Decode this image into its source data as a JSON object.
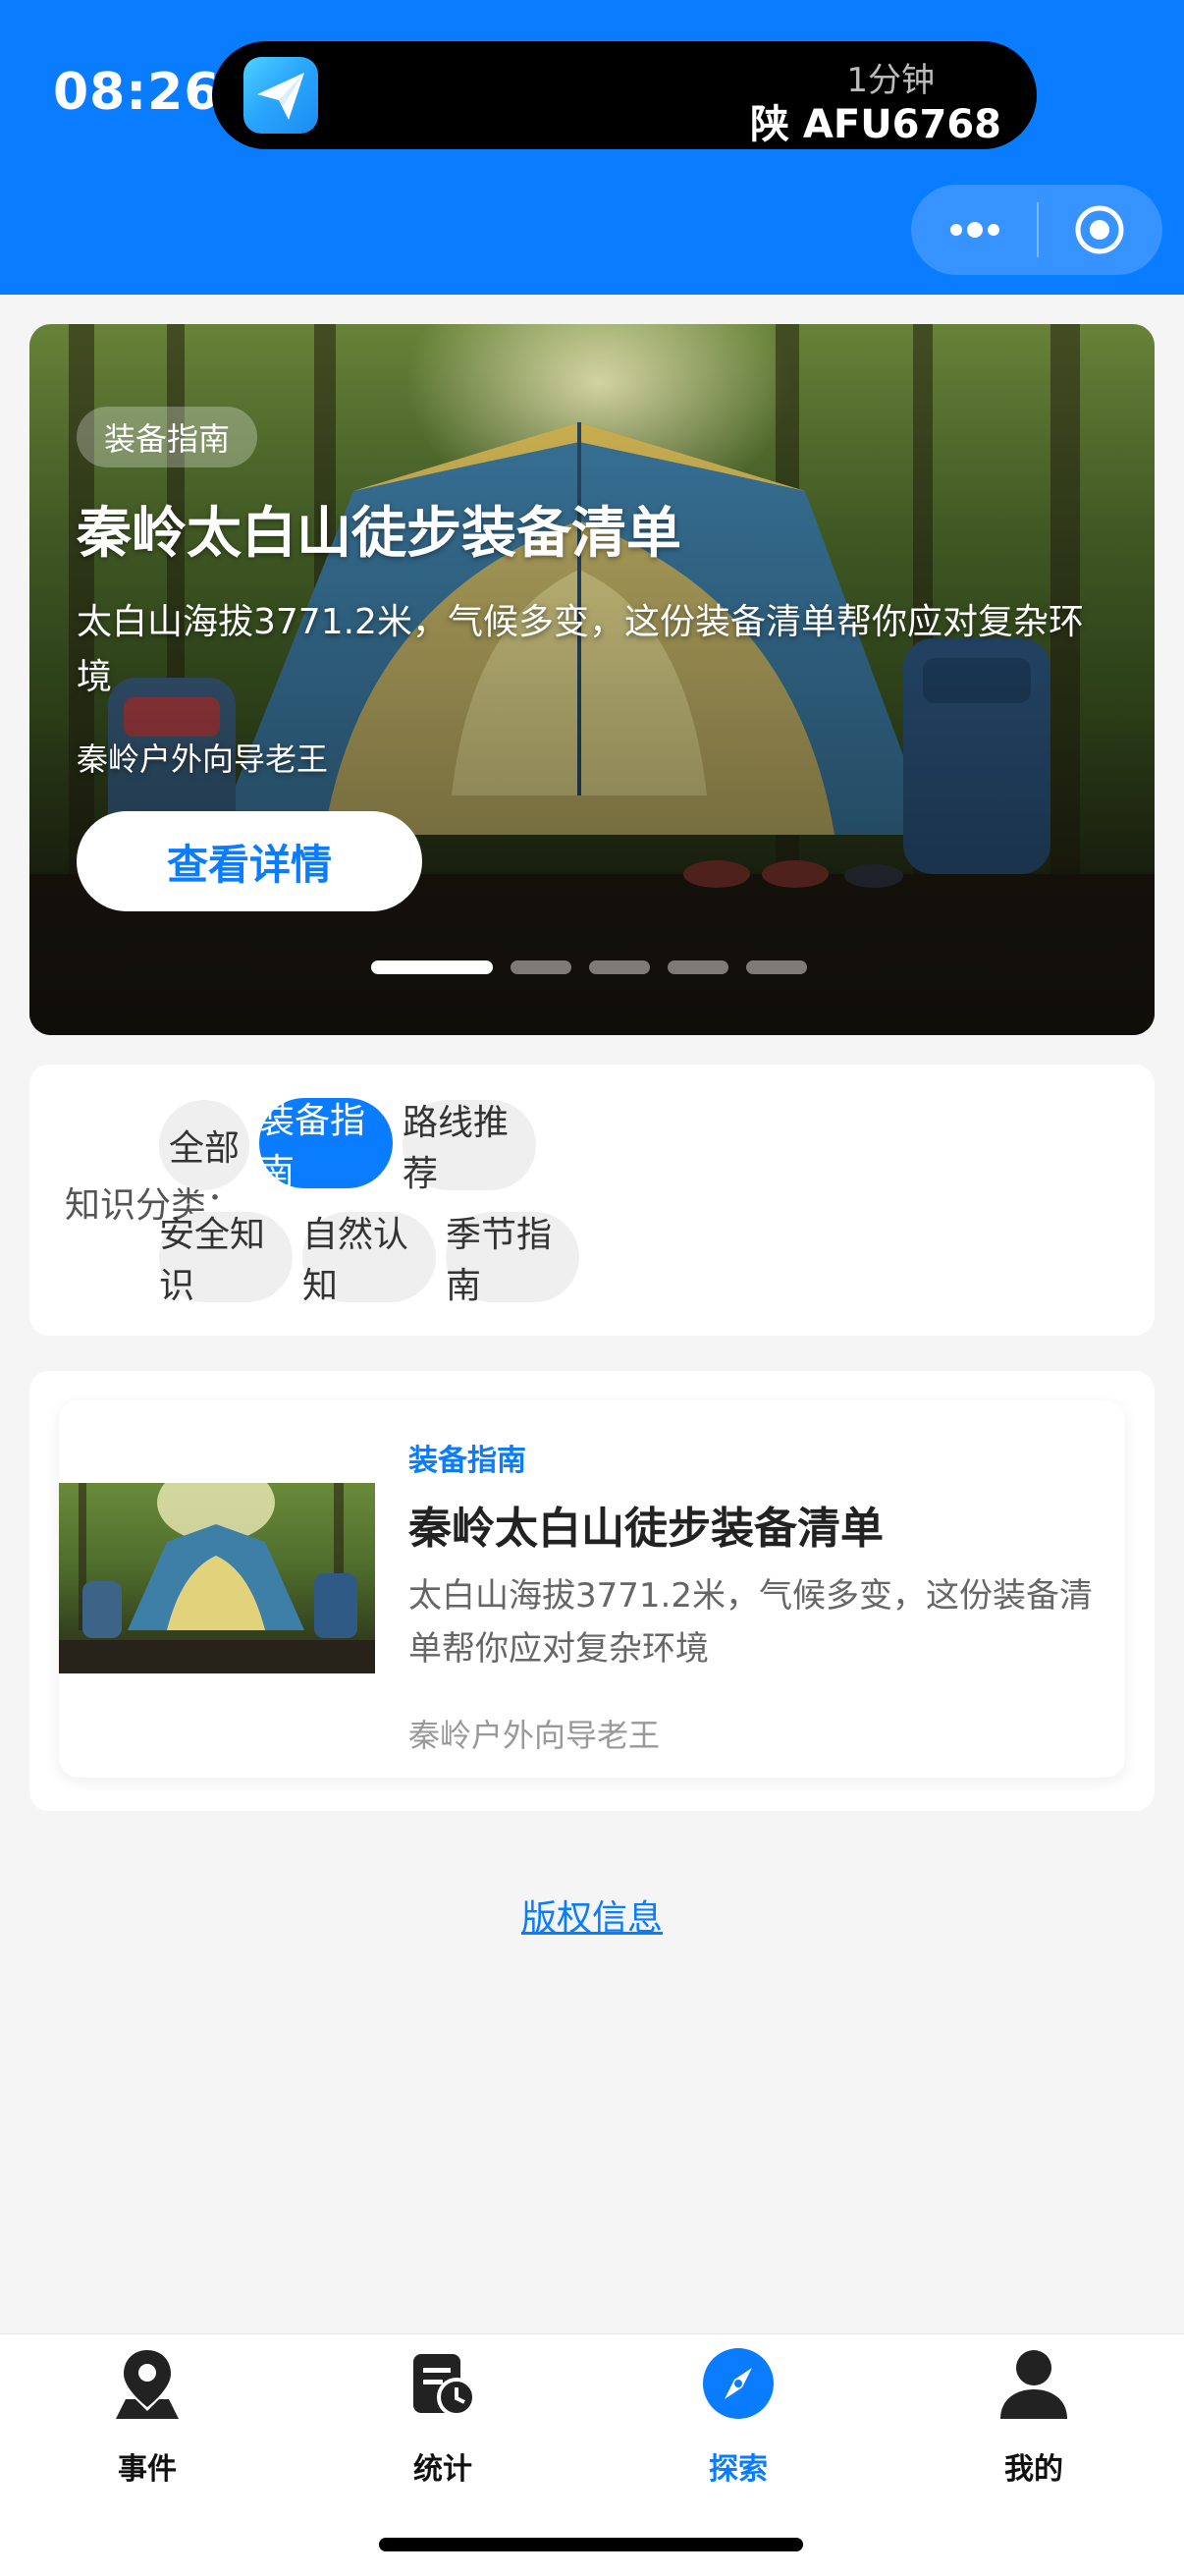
{
  "status_bar": {
    "time": "08:26",
    "island_minutes": "1分钟",
    "island_plate": "陕 AFU6768"
  },
  "colors": {
    "primary": "#0a7cff",
    "background": "#f5f5f5",
    "chip_bg": "#efefef"
  },
  "hero": {
    "tag": "装备指南",
    "title": "秦岭太白山徒步装备清单",
    "description": "太白山海拔3771.2米，气候多变，这份装备清单帮你应对复杂环境",
    "author": "秦岭户外向导老王",
    "button_label": "查看详情",
    "carousel_count": 5,
    "carousel_active_index": 0
  },
  "categories": {
    "label": "知识分类：",
    "chips": [
      {
        "label": "全部",
        "active": false
      },
      {
        "label": "装备指南",
        "active": true
      },
      {
        "label": "路线推荐",
        "active": false
      },
      {
        "label": "安全知识",
        "active": false
      },
      {
        "label": "自然认知",
        "active": false
      },
      {
        "label": "季节指南",
        "active": false
      }
    ]
  },
  "articles": [
    {
      "category": "装备指南",
      "title": "秦岭太白山徒步装备清单",
      "description": "太白山海拔3771.2米，气候多变，这份装备清单帮你应对复杂环境",
      "author": "秦岭户外向导老王",
      "image": "tent-in-forest"
    }
  ],
  "footer": {
    "copyright_link": "版权信息"
  },
  "tabbar": {
    "items": [
      {
        "label": "事件",
        "icon": "location-pin-icon",
        "active": false
      },
      {
        "label": "统计",
        "icon": "calendar-clock-icon",
        "active": false
      },
      {
        "label": "探索",
        "icon": "compass-icon",
        "active": true
      },
      {
        "label": "我的",
        "icon": "person-icon",
        "active": false
      }
    ]
  }
}
